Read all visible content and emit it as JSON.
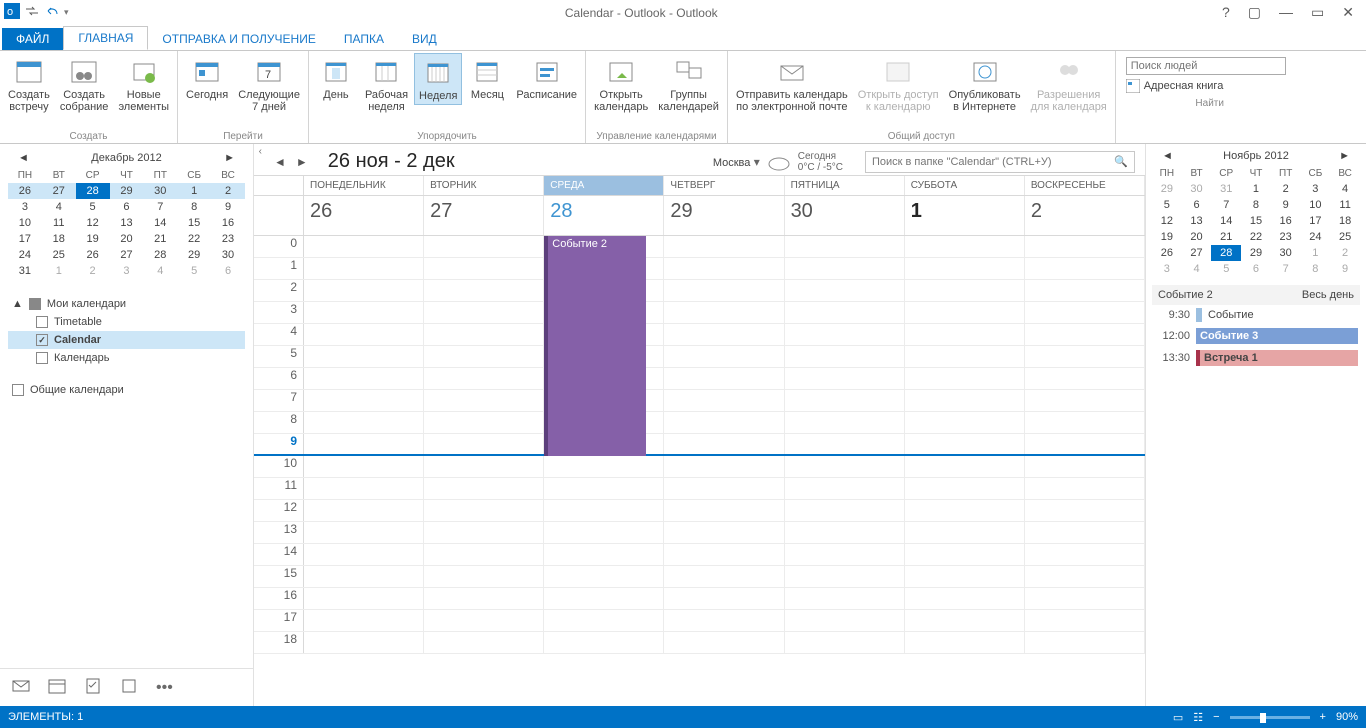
{
  "title": "Calendar - Outlook - Outlook",
  "tabs": {
    "file": "ФАЙЛ",
    "home": "ГЛАВНАЯ",
    "sendrecv": "ОТПРАВКА И ПОЛУЧЕНИЕ",
    "folder": "ПАПКА",
    "view": "ВИД"
  },
  "ribbon": {
    "new": {
      "appt": "Создать\nвстречу",
      "meet": "Создать\nсобрание",
      "items": "Новые\nэлементы",
      "group": "Создать"
    },
    "goto": {
      "today": "Сегодня",
      "next7": "Следующие\n7 дней",
      "group": "Перейти"
    },
    "arrange": {
      "day": "День",
      "work": "Рабочая\nнеделя",
      "week": "Неделя",
      "month": "Месяц",
      "sched": "Расписание",
      "group": "Упорядочить"
    },
    "manage": {
      "open": "Открыть\nкалендарь",
      "groups": "Группы\nкалендарей",
      "group": "Управление календарями"
    },
    "share": {
      "email": "Отправить календарь\nпо электронной почте",
      "access": "Открыть доступ\nк календарю",
      "publish": "Опубликовать\nв Интернете",
      "perm": "Разрешения\nдля календаря",
      "group": "Общий доступ"
    },
    "find": {
      "placeholder": "Поиск людей",
      "addr": "Адресная книга",
      "group": "Найти"
    }
  },
  "left_cal": {
    "title": "Декабрь 2012",
    "dow": [
      "ПН",
      "ВТ",
      "СР",
      "ЧТ",
      "ПТ",
      "СБ",
      "ВС"
    ],
    "rows": [
      [
        "26",
        "27",
        "28",
        "29",
        "30",
        "1",
        "2"
      ],
      [
        "3",
        "4",
        "5",
        "6",
        "7",
        "8",
        "9"
      ],
      [
        "10",
        "11",
        "12",
        "13",
        "14",
        "15",
        "16"
      ],
      [
        "17",
        "18",
        "19",
        "20",
        "21",
        "22",
        "23"
      ],
      [
        "24",
        "25",
        "26",
        "27",
        "28",
        "29",
        "30"
      ],
      [
        "31",
        "1",
        "2",
        "3",
        "4",
        "5",
        "6"
      ]
    ]
  },
  "tree": {
    "my": "Мои календари",
    "timetable": "Timetable",
    "calendar": "Calendar",
    "ru": "Календарь",
    "shared": "Общие календари"
  },
  "center": {
    "range": "26 ноя - 2 дек",
    "city": "Москва",
    "today_lbl": "Сегодня",
    "temp": "0°C / -5°C",
    "search_ph": "Поиск в папке \"Calendar\" (CTRL+У)",
    "dow": [
      "ПОНЕДЕЛЬНИК",
      "ВТОРНИК",
      "СРЕДА",
      "ЧЕТВЕРГ",
      "ПЯТНИЦА",
      "СУББОТА",
      "ВОСКРЕСЕНЬЕ"
    ],
    "dates": [
      "26",
      "27",
      "28",
      "29",
      "30",
      "1",
      "2"
    ],
    "hours": [
      "0",
      "1",
      "2",
      "3",
      "4",
      "5",
      "6",
      "7",
      "8",
      "9",
      "10",
      "11",
      "12",
      "13",
      "14",
      "15",
      "16",
      "17",
      "18"
    ],
    "event": "Событие 2"
  },
  "right_cal": {
    "title": "Ноябрь 2012",
    "dow": [
      "ПН",
      "ВТ",
      "СР",
      "ЧТ",
      "ПТ",
      "СБ",
      "ВС"
    ],
    "rows": [
      [
        "29",
        "30",
        "31",
        "1",
        "2",
        "3",
        "4"
      ],
      [
        "5",
        "6",
        "7",
        "8",
        "9",
        "10",
        "11"
      ],
      [
        "12",
        "13",
        "14",
        "15",
        "16",
        "17",
        "18"
      ],
      [
        "19",
        "20",
        "21",
        "22",
        "23",
        "24",
        "25"
      ],
      [
        "26",
        "27",
        "28",
        "29",
        "30",
        "1",
        "2"
      ],
      [
        "3",
        "4",
        "5",
        "6",
        "7",
        "8",
        "9"
      ]
    ]
  },
  "agenda": {
    "allday_name": "Событие 2",
    "allday_lbl": "Весь день",
    "r1_t": "9:30",
    "r1_n": "Событие",
    "r2_t": "12:00",
    "r2_n": "Событие 3",
    "r3_t": "13:30",
    "r3_n": "Встреча 1"
  },
  "status": {
    "items": "ЭЛЕМЕНТЫ: 1",
    "zoom": "90%"
  }
}
